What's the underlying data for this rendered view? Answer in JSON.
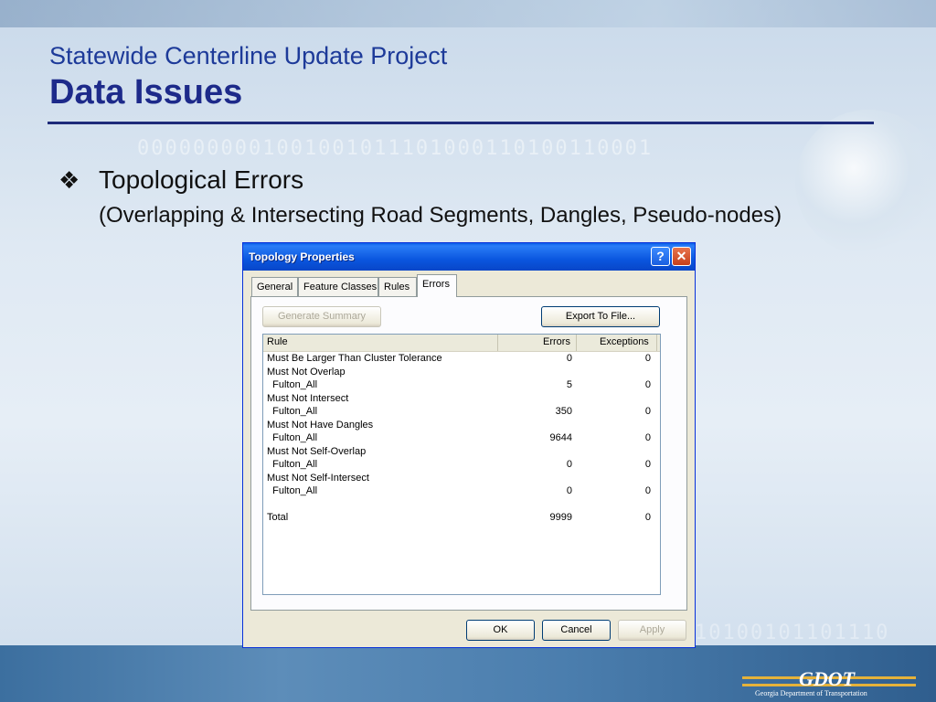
{
  "slide": {
    "title_small": "Statewide Centerline Update Project",
    "title_big": "Data Issues",
    "bullet_icon": "❖",
    "bullet_text": "Topological Errors",
    "bullet_sub": "(Overlapping & Intersecting Road Segments, Dangles, Pseudo-nodes)"
  },
  "dialog": {
    "title": "Topology Properties",
    "help_icon": "?",
    "close_icon": "✕",
    "tabs": [
      "General",
      "Feature Classes",
      "Rules",
      "Errors"
    ],
    "active_tab": "Errors",
    "generate_summary_label": "Generate Summary",
    "export_label": "Export To File...",
    "columns": [
      "Rule",
      "Errors",
      "Exceptions"
    ],
    "rows": [
      {
        "rule": "Must Be Larger Than Cluster Tolerance",
        "errors": "0",
        "exceptions": "0"
      },
      {
        "rule": "Must Not Overlap",
        "errors": "",
        "exceptions": ""
      },
      {
        "rule": "  Fulton_All",
        "errors": "5",
        "exceptions": "0"
      },
      {
        "rule": "Must Not Intersect",
        "errors": "",
        "exceptions": ""
      },
      {
        "rule": "  Fulton_All",
        "errors": "350",
        "exceptions": "0"
      },
      {
        "rule": "Must Not Have Dangles",
        "errors": "",
        "exceptions": ""
      },
      {
        "rule": "  Fulton_All",
        "errors": "9644",
        "exceptions": "0"
      },
      {
        "rule": "Must Not Self-Overlap",
        "errors": "",
        "exceptions": ""
      },
      {
        "rule": "  Fulton_All",
        "errors": "0",
        "exceptions": "0"
      },
      {
        "rule": "Must Not Self-Intersect",
        "errors": "",
        "exceptions": ""
      },
      {
        "rule": "  Fulton_All",
        "errors": "0",
        "exceptions": "0"
      },
      {
        "rule": "",
        "errors": "",
        "exceptions": ""
      },
      {
        "rule": "Total",
        "errors": "9999",
        "exceptions": "0"
      }
    ],
    "ok_label": "OK",
    "cancel_label": "Cancel",
    "apply_label": "Apply"
  },
  "logo": {
    "text": "GDOT",
    "caption": "Georgia Department of Transportation"
  }
}
